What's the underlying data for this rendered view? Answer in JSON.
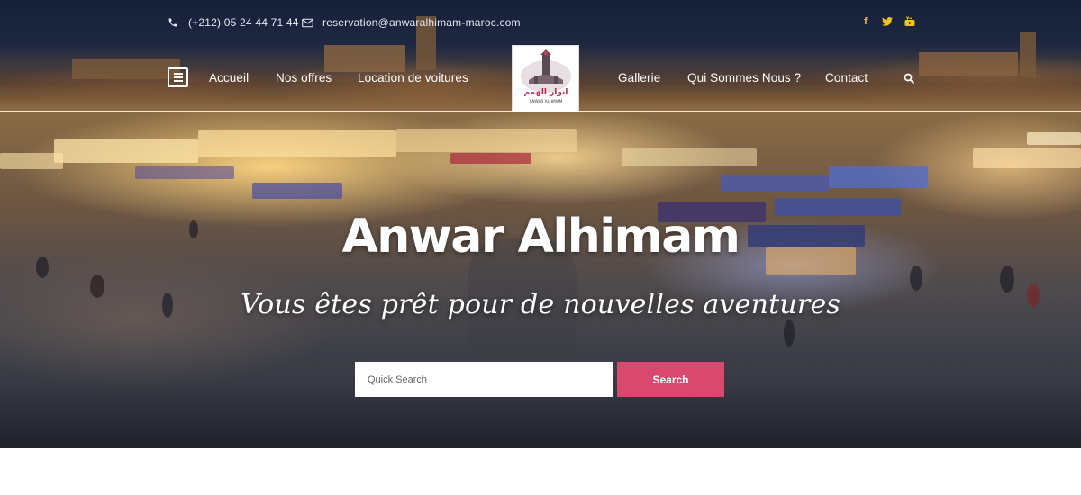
{
  "topbar": {
    "phone": "(+212) 05 24 44 71 44",
    "email": "reservation@anwaralhimam-maroc.com",
    "social": [
      {
        "icon": "facebook-icon",
        "glyph": "f"
      },
      {
        "icon": "twitter-icon",
        "glyph": "t"
      },
      {
        "icon": "youtube-icon",
        "glyph": "▶"
      }
    ]
  },
  "nav": {
    "left": [
      "Accueil",
      "Nos offres",
      "Location de voitures"
    ],
    "right": [
      "Gallerie",
      "Qui Sommes Nous ?",
      "Contact"
    ]
  },
  "logo": {
    "arabic": "انوار الهمم",
    "latin": "ANWAR ALHIMAM"
  },
  "hero": {
    "title": "Anwar Alhimam",
    "subtitle": "Vous êtes prêt pour de nouvelles aventures"
  },
  "search": {
    "placeholder": "Quick Search",
    "button_label": "Search"
  },
  "colors": {
    "accent": "#d9486f",
    "social": "#f1c31e"
  }
}
